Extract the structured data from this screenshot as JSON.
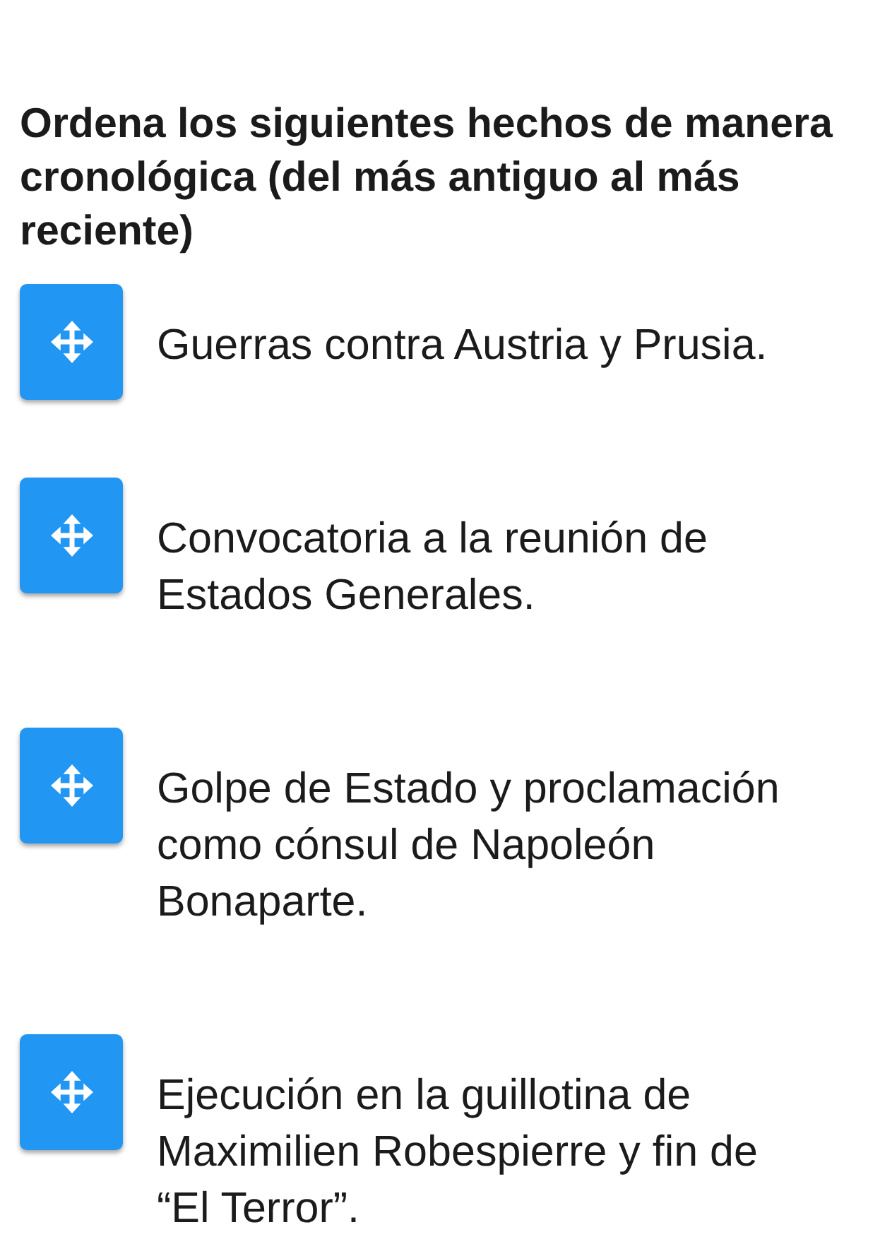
{
  "question": "Ordena los siguientes hechos de manera cronológica (del más antiguo al más reciente)",
  "items": [
    {
      "text": "Guerras contra Austria y Prusia."
    },
    {
      "text": "Convocatoria a la reunión de Estados Generales."
    },
    {
      "text": "Golpe de Estado y proclamación como cónsul de Napoleón Bonaparte."
    },
    {
      "text": "Ejecución en la guillotina de Maximilien Robespierre y fin de “El Terror”."
    }
  ]
}
